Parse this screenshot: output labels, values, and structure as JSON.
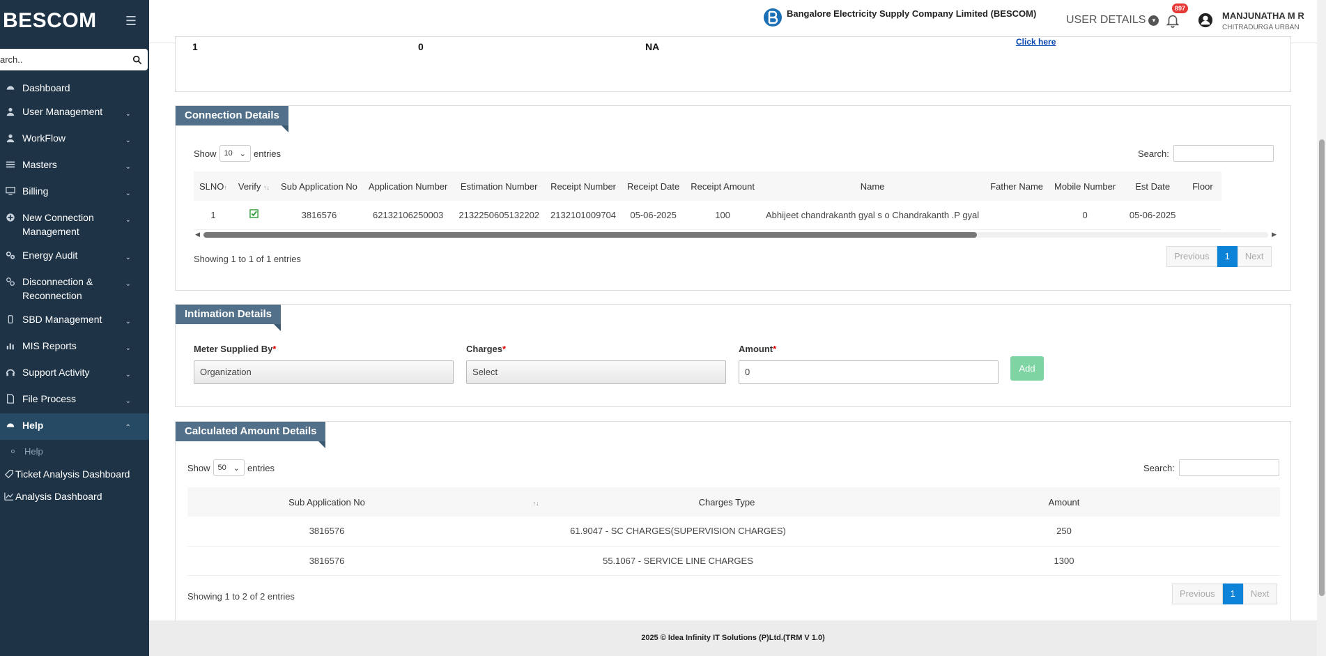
{
  "sidebar": {
    "brand": "BESCOM",
    "search_placeholder": "arch..",
    "items": [
      {
        "label": "Dashboard",
        "chevron": false
      },
      {
        "label": "User Management",
        "chevron": true
      },
      {
        "label": "WorkFlow",
        "chevron": true
      },
      {
        "label": "Masters",
        "chevron": true
      },
      {
        "label": "Billing",
        "chevron": true
      },
      {
        "label": "New Connection Management",
        "chevron": true
      },
      {
        "label": "Energy Audit",
        "chevron": true
      },
      {
        "label": "Disconnection & Reconnection",
        "chevron": true
      },
      {
        "label": "SBD Management",
        "chevron": true
      },
      {
        "label": "MIS Reports",
        "chevron": true
      },
      {
        "label": "Support Activity",
        "chevron": true
      },
      {
        "label": "File Process",
        "chevron": true
      },
      {
        "label": "Help",
        "chevron": true,
        "active": true
      }
    ],
    "sub_item": "Help",
    "extra_items": [
      "Ticket Analysis Dashboard",
      "Analysis Dashboard"
    ]
  },
  "header": {
    "company": "Bangalore Electricity Supply Company Limited (BESCOM)",
    "user_details": "USER DETAILS",
    "notification_count": "897",
    "username": "MANJUNATHA M R",
    "location": "CHITRADURGA URBAN"
  },
  "top_row": {
    "col1": "1",
    "col2": "0",
    "col3": "NA",
    "link": "Click here"
  },
  "connection": {
    "title": "Connection Details",
    "show_label": "Show",
    "entries_label": "entries",
    "page_length": "10",
    "search_label": "Search:",
    "headers": [
      "SLNO",
      "Verify",
      "Sub Application No",
      "Application Number",
      "Estimation Number",
      "Receipt Number",
      "Receipt Date",
      "Receipt Amount",
      "Name",
      "Father Name",
      "Mobile Number",
      "Est Date",
      "Floor"
    ],
    "rows": [
      [
        "1",
        "",
        "3816576",
        "62132106250003",
        "2132250605132202",
        "2132101009704",
        "05-06-2025",
        "100",
        "Abhijeet chandrakanth gyal s o Chandrakanth .P gyal",
        "",
        "0",
        "05-06-2025",
        ""
      ]
    ],
    "info": "Showing 1 to 1 of 1 entries",
    "pager": {
      "prev": "Previous",
      "page": "1",
      "next": "Next"
    }
  },
  "intimation": {
    "title": "Intimation Details",
    "meter_label": "Meter Supplied By",
    "meter_value": "Organization",
    "charges_label": "Charges",
    "charges_value": "Select",
    "amount_label": "Amount",
    "amount_value": "0",
    "required_mark": "*",
    "add_label": "Add"
  },
  "calculated": {
    "title": "Calculated Amount Details",
    "show_label": "Show",
    "entries_label": "entries",
    "page_length": "50",
    "search_label": "Search:",
    "headers": [
      "Sub Application No",
      "Charges Type",
      "Amount"
    ],
    "sort_mark": "↑↓",
    "rows": [
      [
        "3816576",
        "61.9047 - SC CHARGES(SUPERVISION CHARGES)",
        "250"
      ],
      [
        "3816576",
        "55.1067 - SERVICE LINE CHARGES",
        "1300"
      ]
    ],
    "info": "Showing 1 to 2 of 2 entries",
    "pager": {
      "prev": "Previous",
      "page": "1",
      "next": "Next"
    }
  },
  "footer": "2025 © Idea Infinity IT Solutions (P)Ltd.(TRM V 1.0)"
}
